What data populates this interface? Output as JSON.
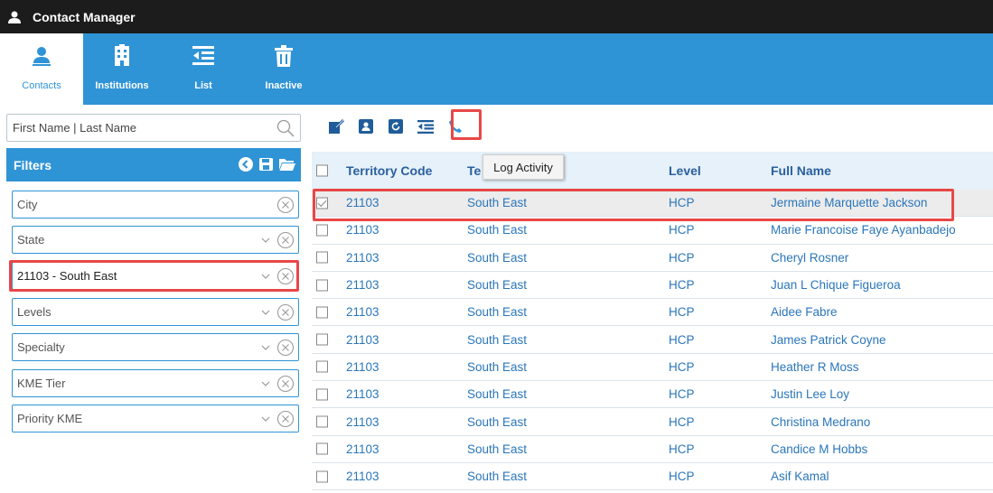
{
  "app": {
    "title": "Contact Manager"
  },
  "nav": {
    "items": [
      {
        "label": "Contacts",
        "icon": "contacts-icon",
        "active": true
      },
      {
        "label": "Institutions",
        "icon": "institution-icon",
        "active": false
      },
      {
        "label": "List",
        "icon": "list-icon",
        "active": false
      },
      {
        "label": "Inactive",
        "icon": "trash-icon",
        "active": false
      }
    ]
  },
  "search": {
    "placeholder": "First Name | Last Name",
    "value": ""
  },
  "filters": {
    "title": "Filters",
    "fields": [
      {
        "value": "City",
        "has_dropdown": false,
        "selected": false
      },
      {
        "value": "State",
        "has_dropdown": true,
        "selected": false
      },
      {
        "value": "21103 - South East",
        "has_dropdown": true,
        "selected": true
      },
      {
        "value": "Levels",
        "has_dropdown": true,
        "selected": false
      },
      {
        "value": "Specialty",
        "has_dropdown": true,
        "selected": false
      },
      {
        "value": "KME Tier",
        "has_dropdown": true,
        "selected": false
      },
      {
        "value": "Priority KME",
        "has_dropdown": true,
        "selected": false
      }
    ]
  },
  "toolbar": {
    "buttons": [
      "edit-icon",
      "contact-card-icon",
      "refresh-icon",
      "list-icon",
      "phone-icon"
    ],
    "tooltip": "Log Activity"
  },
  "grid": {
    "columns": {
      "territory_code": "Territory Code",
      "territory": "Te",
      "level": "Level",
      "full_name": "Full Name"
    },
    "rows": [
      {
        "checked": true,
        "code": "21103",
        "territory": "South East",
        "level": "HCP",
        "name": "Jermaine Marquette Jackson"
      },
      {
        "checked": false,
        "code": "21103",
        "territory": "South East",
        "level": "HCP",
        "name": "Marie Francoise Faye Ayanbadejo"
      },
      {
        "checked": false,
        "code": "21103",
        "territory": "South East",
        "level": "HCP",
        "name": "Cheryl Rosner"
      },
      {
        "checked": false,
        "code": "21103",
        "territory": "South East",
        "level": "HCP",
        "name": "Juan L Chique Figueroa"
      },
      {
        "checked": false,
        "code": "21103",
        "territory": "South East",
        "level": "HCP",
        "name": "Aidee Fabre"
      },
      {
        "checked": false,
        "code": "21103",
        "territory": "South East",
        "level": "HCP",
        "name": "James Patrick Coyne"
      },
      {
        "checked": false,
        "code": "21103",
        "territory": "South East",
        "level": "HCP",
        "name": "Heather R Moss"
      },
      {
        "checked": false,
        "code": "21103",
        "territory": "South East",
        "level": "HCP",
        "name": "Justin Lee Loy"
      },
      {
        "checked": false,
        "code": "21103",
        "territory": "South East",
        "level": "HCP",
        "name": "Christina Medrano"
      },
      {
        "checked": false,
        "code": "21103",
        "territory": "South East",
        "level": "HCP",
        "name": "Candice M Hobbs"
      },
      {
        "checked": false,
        "code": "21103",
        "territory": "South East",
        "level": "HCP",
        "name": "Asif Kamal"
      }
    ]
  },
  "colors": {
    "titlebar": "#1c1c1c",
    "brand_blue": "#2f94d6",
    "link_blue": "#2a76ba",
    "highlight_red": "#e84747"
  }
}
